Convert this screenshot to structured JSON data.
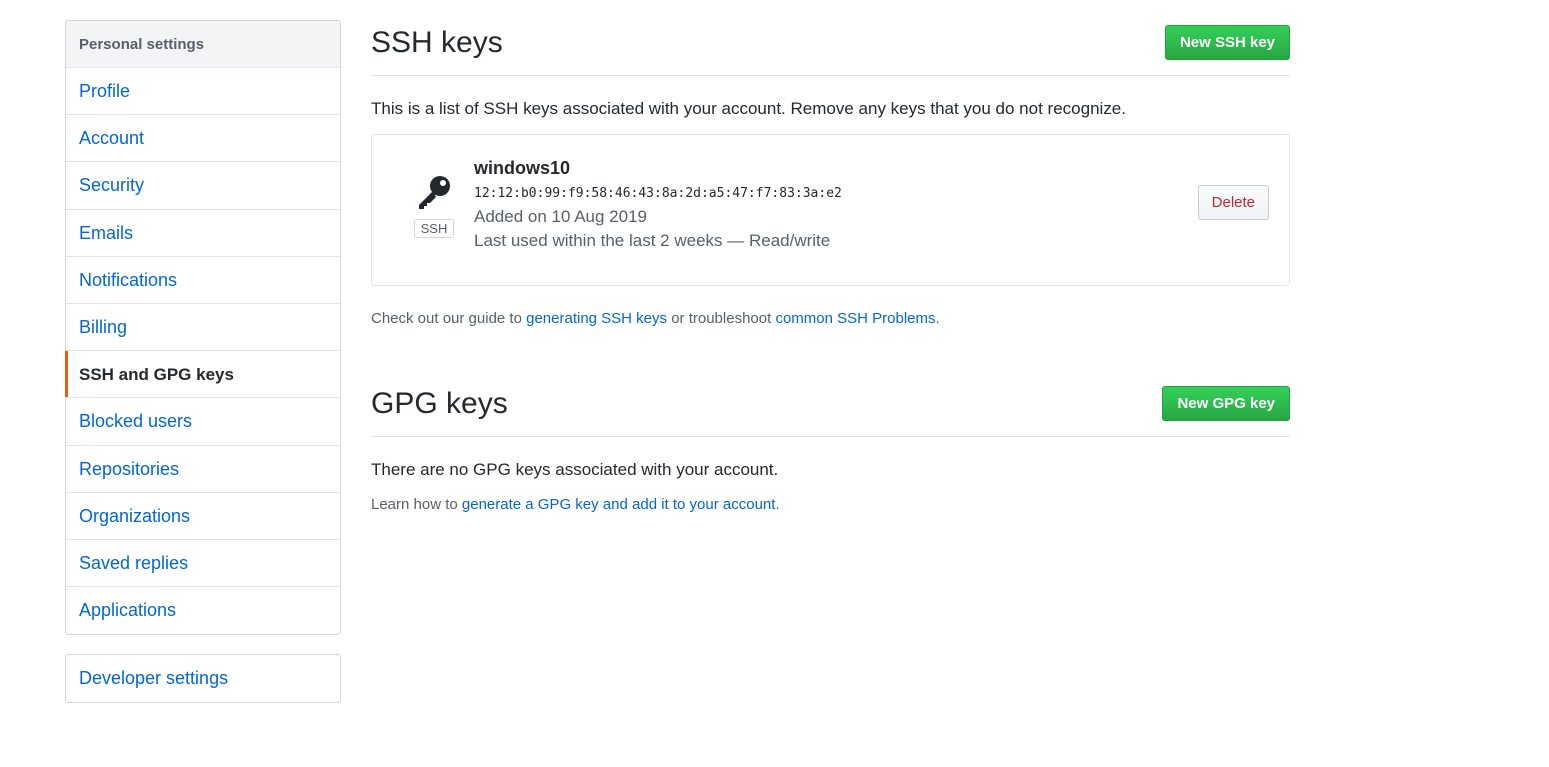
{
  "sidebar": {
    "heading": "Personal settings",
    "items": [
      {
        "label": "Profile"
      },
      {
        "label": "Account"
      },
      {
        "label": "Security"
      },
      {
        "label": "Emails"
      },
      {
        "label": "Notifications"
      },
      {
        "label": "Billing"
      },
      {
        "label": "SSH and GPG keys",
        "selected": true
      },
      {
        "label": "Blocked users"
      },
      {
        "label": "Repositories"
      },
      {
        "label": "Organizations"
      },
      {
        "label": "Saved replies"
      },
      {
        "label": "Applications"
      }
    ],
    "developer_settings": "Developer settings"
  },
  "ssh": {
    "title": "SSH keys",
    "new_button": "New SSH key",
    "intro": "This is a list of SSH keys associated with your account. Remove any keys that you do not recognize.",
    "keys": [
      {
        "icon": "key-icon",
        "type_label": "SSH",
        "title": "windows10",
        "fingerprint": "12:12:b0:99:f9:58:46:43:8a:2d:a5:47:f7:83:3a:e2",
        "added": "Added on 10 Aug 2019",
        "last_used": "Last used within the last 2 weeks — Read/write",
        "delete_label": "Delete"
      }
    ],
    "guide": {
      "prefix": "Check out our guide to ",
      "link1": "generating SSH keys",
      "middle": " or troubleshoot ",
      "link2": "common SSH Problems",
      "suffix": "."
    }
  },
  "gpg": {
    "title": "GPG keys",
    "new_button": "New GPG key",
    "empty": "There are no GPG keys associated with your account.",
    "learn": {
      "prefix": "Learn how to ",
      "link": "generate a GPG key and add it to your account",
      "suffix": "."
    }
  },
  "colors": {
    "accent_selected": "#e36209",
    "primary_button": "#28a745",
    "link": "#0366d6",
    "danger": "#cb2431"
  }
}
